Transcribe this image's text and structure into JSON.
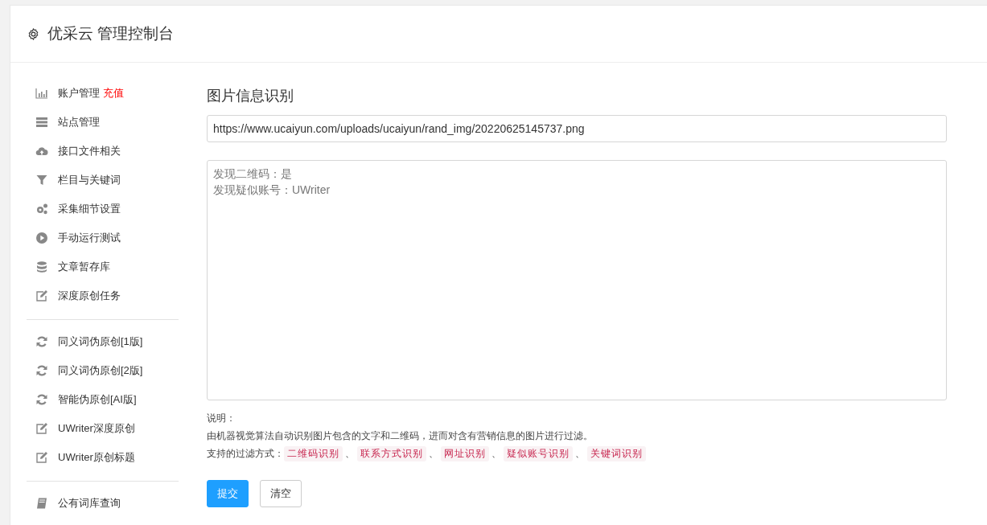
{
  "header": {
    "title": "优采云 管理控制台"
  },
  "sidebar": {
    "groups": [
      {
        "items": [
          {
            "label": "账户管理",
            "badge": "充值"
          },
          {
            "label": "站点管理"
          },
          {
            "label": "接口文件相关"
          },
          {
            "label": "栏目与关键词"
          },
          {
            "label": "采集细节设置"
          },
          {
            "label": "手动运行测试"
          },
          {
            "label": "文章暂存库"
          },
          {
            "label": "深度原创任务"
          }
        ]
      },
      {
        "items": [
          {
            "label": "同义词伪原创[1版]"
          },
          {
            "label": "同义词伪原创[2版]"
          },
          {
            "label": "智能伪原创[AI版]"
          },
          {
            "label": "UWriter深度原创"
          },
          {
            "label": "UWriter原创标题"
          }
        ]
      },
      {
        "items": [
          {
            "label": "公有词库查询"
          }
        ]
      }
    ]
  },
  "main": {
    "title": "图片信息识别",
    "url_field": {
      "value": "https://www.ucaiyun.com/uploads/ucaiyun/rand_img/20220625145737.png"
    },
    "result_box": {
      "lines": [
        "发现二维码：是",
        "发现疑似账号：UWriter"
      ]
    },
    "note_label": "说明：",
    "note_text": "由机器视觉算法自动识别图片包含的文字和二维码，进而对含有营销信息的图片进行过滤。",
    "filter_label": "支持的过滤方式：",
    "filter_separator": "、",
    "filter_methods": [
      "二维码识别",
      "联系方式识别",
      "网址识别",
      "疑似账号识别",
      "关键词识别"
    ],
    "buttons": [
      {
        "label": "提交",
        "kind": "primary"
      },
      {
        "label": "清空",
        "kind": "default"
      }
    ]
  }
}
